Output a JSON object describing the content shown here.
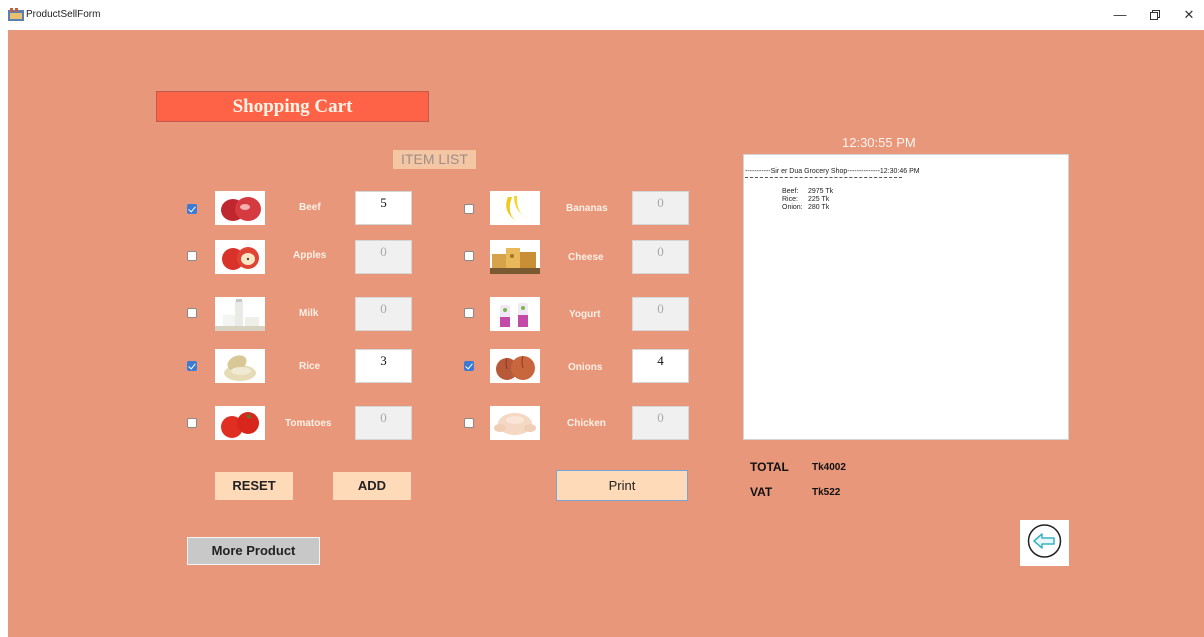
{
  "window": {
    "title": "ProductSellForm"
  },
  "header": {
    "title": "Shopping Cart",
    "item_list_label": "ITEM LIST"
  },
  "items_left": [
    {
      "name": "Beef",
      "checked": true,
      "qty": "5",
      "icon": "beef-icon"
    },
    {
      "name": "Apples",
      "checked": false,
      "qty": "0",
      "icon": "apples-icon"
    },
    {
      "name": "Milk",
      "checked": false,
      "qty": "0",
      "icon": "milk-icon"
    },
    {
      "name": "Rice",
      "checked": true,
      "qty": "3",
      "icon": "rice-icon"
    },
    {
      "name": "Tomatoes",
      "checked": false,
      "qty": "0",
      "icon": "tomatoes-icon"
    }
  ],
  "items_right": [
    {
      "name": "Bananas",
      "checked": false,
      "qty": "0",
      "icon": "bananas-icon"
    },
    {
      "name": "Cheese",
      "checked": false,
      "qty": "0",
      "icon": "cheese-icon"
    },
    {
      "name": "Yogurt",
      "checked": false,
      "qty": "0",
      "icon": "yogurt-icon"
    },
    {
      "name": "Onions",
      "checked": true,
      "qty": "4",
      "icon": "onions-icon"
    },
    {
      "name": "Chicken",
      "checked": false,
      "qty": "0",
      "icon": "chicken-icon"
    }
  ],
  "buttons": {
    "reset": "RESET",
    "add": "ADD",
    "print": "Print",
    "more_product": "More Product"
  },
  "clock": "12:30:55 PM",
  "receipt": {
    "header": "-----------Sir er Dua Grocery Shop--------------12:30:46 PM",
    "lines": [
      {
        "item": "Beef:",
        "amount": "2975 Tk"
      },
      {
        "item": "Rice:",
        "amount": "225 Tk"
      },
      {
        "item": "Onion:",
        "amount": "280 Tk"
      }
    ]
  },
  "totals": {
    "total_label": "TOTAL",
    "total_value": "Tk4002",
    "vat_label": "VAT",
    "vat_value": "Tk522"
  },
  "colors": {
    "background": "#e8977a",
    "banner": "#ff6347",
    "button": "#ffdab9",
    "checkbox_checked": "#3b7bd6"
  }
}
